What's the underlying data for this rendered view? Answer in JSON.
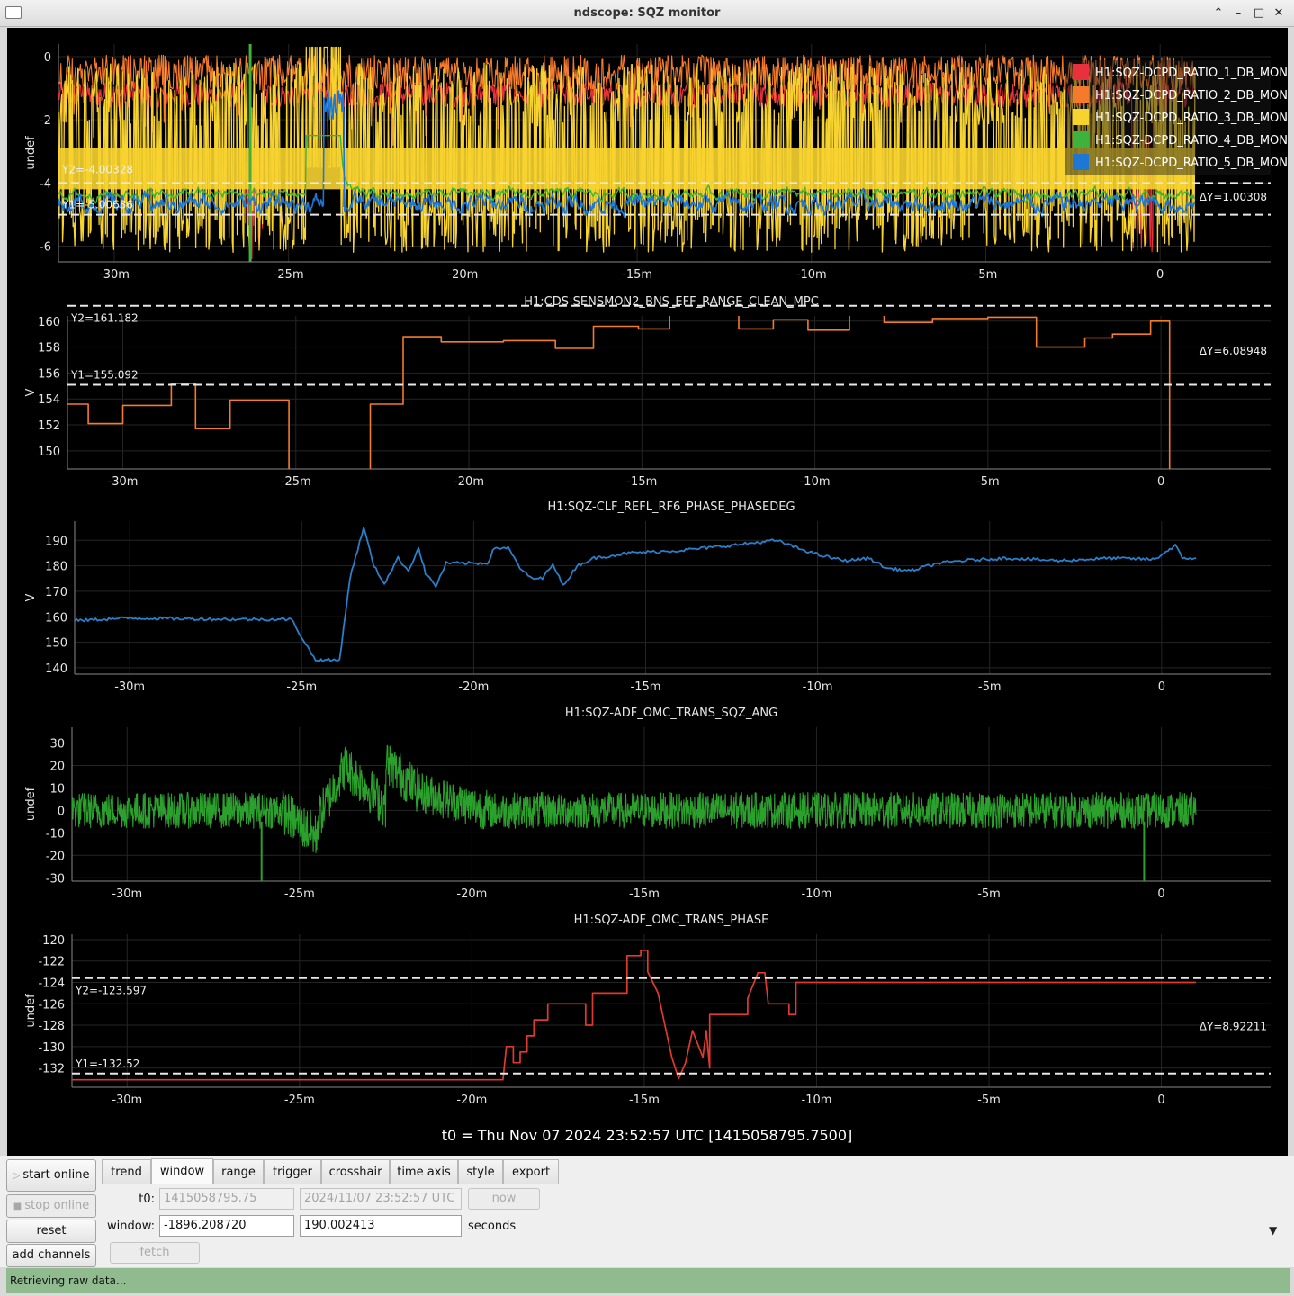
{
  "window": {
    "title": "ndscope: SQZ monitor",
    "buttons": [
      "⌃",
      "–",
      "□",
      "✕"
    ]
  },
  "xaxis": {
    "tick_labels": [
      "-30m",
      "-25m",
      "-20m",
      "-15m",
      "-10m",
      "-5m",
      "0"
    ],
    "tick_values_min": [
      -30,
      -25,
      -20,
      -15,
      -10,
      -5,
      0
    ],
    "range_min": [
      -31.6,
      3.17
    ]
  },
  "t0_label": "t0 = Thu Nov 07 2024 23:52:57 UTC [1415058795.7500]",
  "plots": [
    {
      "title": "",
      "ylabel": "undef",
      "ylim": [
        -6.5,
        0.4
      ],
      "yticks": [
        "0",
        "-2",
        "-4",
        "-6"
      ],
      "ytick_values": [
        0,
        -2,
        -4,
        -6
      ],
      "legend": [
        {
          "name": "H1:SQZ-DCPD_RATIO_1_DB_MON",
          "color": "#e8313d"
        },
        {
          "name": "H1:SQZ-DCPD_RATIO_2_DB_MON",
          "color": "#f47a2c"
        },
        {
          "name": "H1:SQZ-DCPD_RATIO_3_DB_MON",
          "color": "#f7d330"
        },
        {
          "name": "H1:SQZ-DCPD_RATIO_4_DB_MON",
          "color": "#3db33d"
        },
        {
          "name": "H1:SQZ-DCPD_RATIO_5_DB_MON",
          "color": "#1f77d4"
        }
      ],
      "cursors": {
        "y1_label": "Y1=-5.00636",
        "y2_label": "Y2=-4.00328",
        "y1": -5.00636,
        "y2": -4.00328,
        "delta_label": "ΔY=1.00308"
      }
    },
    {
      "title": "H1:CDS-SENSMON2_BNS_EFF_RANGE_CLEAN_MPC",
      "ylabel": "V",
      "ylim": [
        148.6,
        160.4
      ],
      "yticks": [
        "160",
        "158",
        "156",
        "154",
        "152",
        "150"
      ],
      "ytick_values": [
        160,
        158,
        156,
        154,
        152,
        150
      ],
      "color": "#f47a2c",
      "cursors": {
        "y1_label": "Y1=155.092",
        "y2_label": "Y2=161.182",
        "y1": 155.092,
        "y2": 161.182,
        "delta_label": "ΔY=6.08948"
      }
    },
    {
      "title": "H1:SQZ-CLF_REFL_RF6_PHASE_PHASEDEG",
      "ylabel": "V",
      "ylim": [
        137.5,
        197.5
      ],
      "yticks": [
        "190",
        "180",
        "170",
        "160",
        "150",
        "140"
      ],
      "ytick_values": [
        190,
        180,
        170,
        160,
        150,
        140
      ],
      "color": "#2a7fc8"
    },
    {
      "title": "H1:SQZ-ADF_OMC_TRANS_SQZ_ANG",
      "ylabel": "undef",
      "ylim": [
        -31.5,
        37
      ],
      "yticks": [
        "30",
        "20",
        "10",
        "0",
        "-10",
        "-20",
        "-30"
      ],
      "ytick_values": [
        30,
        20,
        10,
        0,
        -10,
        -20,
        -30
      ],
      "color": "#2ca02c"
    },
    {
      "title": "H1:SQZ-ADF_OMC_TRANS_PHASE",
      "ylabel": "undef",
      "ylim": [
        -133.8,
        -119.5
      ],
      "yticks": [
        "-120",
        "-122",
        "-124",
        "-126",
        "-128",
        "-130",
        "-132"
      ],
      "ytick_values": [
        -120,
        -122,
        -124,
        -126,
        -128,
        -130,
        -132
      ],
      "color": "#e03a2e",
      "cursors": {
        "y1_label": "Y1=-132.52",
        "y2_label": "Y2=-123.597",
        "y1": -132.52,
        "y2": -123.597,
        "delta_label": "ΔY=8.92211"
      }
    }
  ],
  "sidebar": {
    "start_online": "start online",
    "stop_online": "stop online",
    "reset": "reset",
    "add_channels": "add channels"
  },
  "tabs": [
    "trend",
    "window",
    "range",
    "trigger",
    "crosshair",
    "time axis",
    "style",
    "export"
  ],
  "active_tab": "window",
  "window_tab": {
    "t0_label": "t0:",
    "t0_gps": "1415058795.75",
    "t0_utc": "2024/11/07 23:52:57 UTC",
    "now_label": "now",
    "window_label": "window:",
    "window_start": "-1896.208720",
    "window_end": "190.002413",
    "seconds_label": "seconds",
    "fetch_label": "fetch"
  },
  "status": "Retrieving raw data..."
}
